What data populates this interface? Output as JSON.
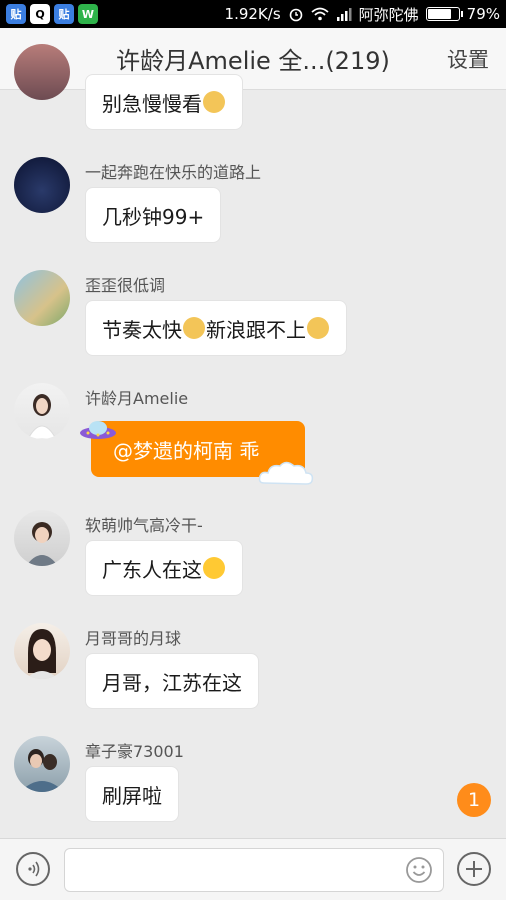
{
  "status_bar": {
    "speed": "1.92K/s",
    "carrier": "阿弥陀佛",
    "battery": "79%",
    "battery_level": 0.79
  },
  "header": {
    "back_icon": "arrow-left-icon",
    "title": "许龄月Amelie 全...(219)",
    "settings_label": "设置"
  },
  "messages": [
    {
      "sender": "",
      "text": "别急慢慢看",
      "emoji_after": true
    },
    {
      "sender": "一起奔跑在快乐的道路上",
      "text": "几秒钟99+"
    },
    {
      "sender": "歪歪很低调",
      "text_a": "节奏太快",
      "text_b": "新浪跟不上"
    },
    {
      "sender": "许龄月Amelie",
      "text": "@梦遗的柯南 乖"
    },
    {
      "sender": "软萌帅气高冷干-",
      "text": "广东人在这"
    },
    {
      "sender": "月哥哥的月球",
      "text": "月哥，江苏在这"
    },
    {
      "sender": "章子豪73001",
      "text": "刷屏啦"
    }
  ],
  "unread_badge": "1",
  "input": {
    "value": "",
    "placeholder": ""
  },
  "colors": {
    "accent": "#ff8c00",
    "badge": "#ff8c1a"
  }
}
